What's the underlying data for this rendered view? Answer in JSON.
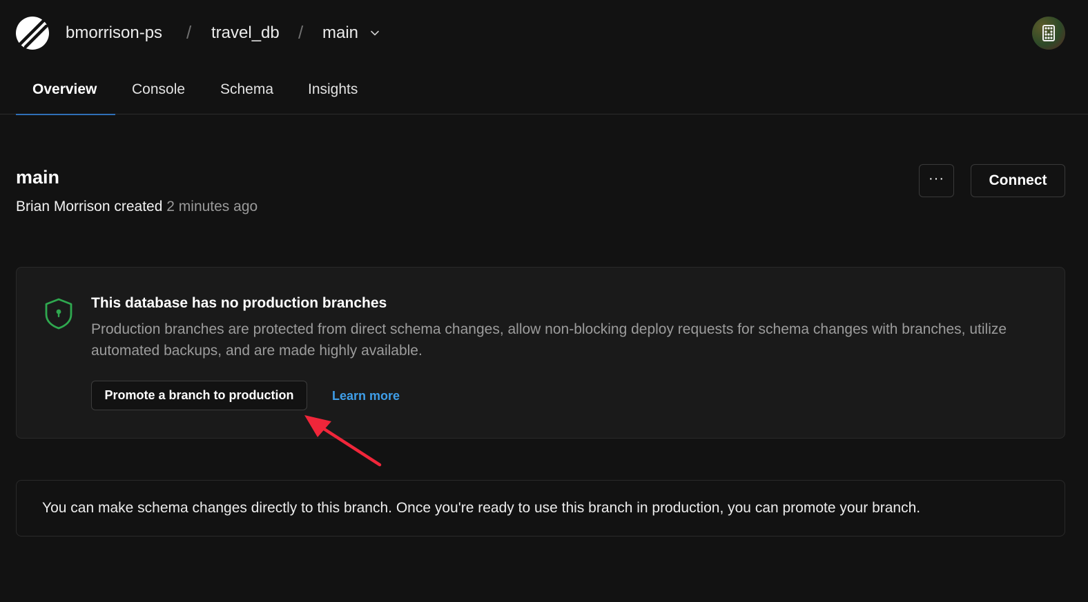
{
  "header": {
    "org": "bmorrison-ps",
    "separator": "/",
    "database": "travel_db",
    "branch": "main",
    "logo_icon": "planetscale-logo-icon",
    "avatar_icon": "user-avatar-icon"
  },
  "tabs": [
    {
      "label": "Overview",
      "active": true
    },
    {
      "label": "Console",
      "active": false
    },
    {
      "label": "Schema",
      "active": false
    },
    {
      "label": "Insights",
      "active": false
    }
  ],
  "branch_header": {
    "title": "main",
    "author": "Brian Morrison created",
    "age": "2 minutes ago",
    "more_label": "···",
    "connect_label": "Connect"
  },
  "notice": {
    "icon": "shield-keyhole-icon",
    "title": "This database has no production branches",
    "body": "Production branches are protected from direct schema changes, allow non-blocking deploy requests for schema changes with branches, utilize automated backups, and are made highly available.",
    "promote_label": "Promote a branch to production",
    "learn_more_label": "Learn more"
  },
  "info": {
    "text": "You can make schema changes directly to this branch. Once you're ready to use this branch in production, you can promote your branch."
  },
  "colors": {
    "background": "#121212",
    "panel": "#1a1a1a",
    "accent_link": "#3f9ee8",
    "tab_underline": "#2f6fb7",
    "shield": "#2fa84f",
    "annotation_arrow": "#f0263a"
  }
}
